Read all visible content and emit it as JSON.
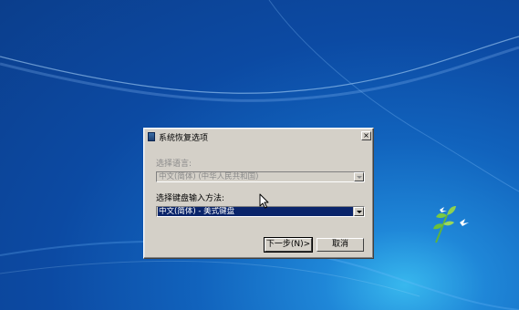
{
  "dialog": {
    "title": "系统恢复选项",
    "close_label": "×",
    "language_label": "选择语言:",
    "language_value": "中文(简体) (中华人民共和国)",
    "keyboard_label": "选择键盘输入方法:",
    "keyboard_value": "中文(简体) - 美式键盘",
    "next_button": "下一步(N)>",
    "cancel_button": "取消"
  },
  "icons": {
    "app": "system-recovery-icon",
    "dropdown": "chevron-down-icon",
    "cursor": "mouse-pointer-icon",
    "desktop_logo": "branch-birds-icon"
  },
  "colors": {
    "desktop_bg": "#1163bd",
    "dialog_face": "#d4d0c8",
    "selection": "#0a246a",
    "disabled_text": "#8a8a8a"
  }
}
